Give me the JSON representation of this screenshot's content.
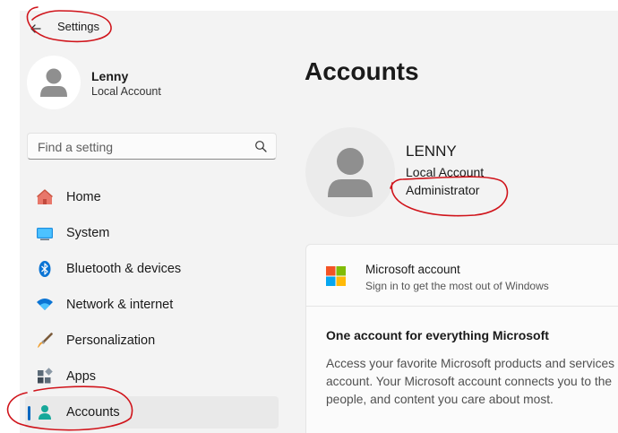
{
  "titlebar": {
    "title": "Settings",
    "back_icon": "arrow-left-icon"
  },
  "profile": {
    "name": "Lenny",
    "account_type": "Local Account",
    "avatar_icon": "person-icon"
  },
  "search": {
    "placeholder": "Find a setting",
    "icon": "search-icon"
  },
  "nav": {
    "items": [
      {
        "label": "Home",
        "icon": "home-icon",
        "selected": false
      },
      {
        "label": "System",
        "icon": "monitor-icon",
        "selected": false
      },
      {
        "label": "Bluetooth & devices",
        "icon": "bluetooth-icon",
        "selected": false
      },
      {
        "label": "Network & internet",
        "icon": "wifi-icon",
        "selected": false
      },
      {
        "label": "Personalization",
        "icon": "brush-icon",
        "selected": false
      },
      {
        "label": "Apps",
        "icon": "apps-icon",
        "selected": false
      },
      {
        "label": "Accounts",
        "icon": "accounts-icon",
        "selected": true
      }
    ]
  },
  "main": {
    "title": "Accounts",
    "account": {
      "name": "LENNY",
      "type": "Local Account",
      "role": "Administrator"
    },
    "ms_card": {
      "title": "Microsoft account",
      "subtitle": "Sign in to get the most out of Windows",
      "heading": "One account for everything Microsoft",
      "body_lines": [
        "Access your favorite Microsoft products and services",
        "account. Your Microsoft account connects you to the",
        "people, and content you care about most."
      ]
    }
  },
  "colors": {
    "accent": "#0067c0",
    "annotation": "#d0141b",
    "background": "#f3f3f3"
  }
}
